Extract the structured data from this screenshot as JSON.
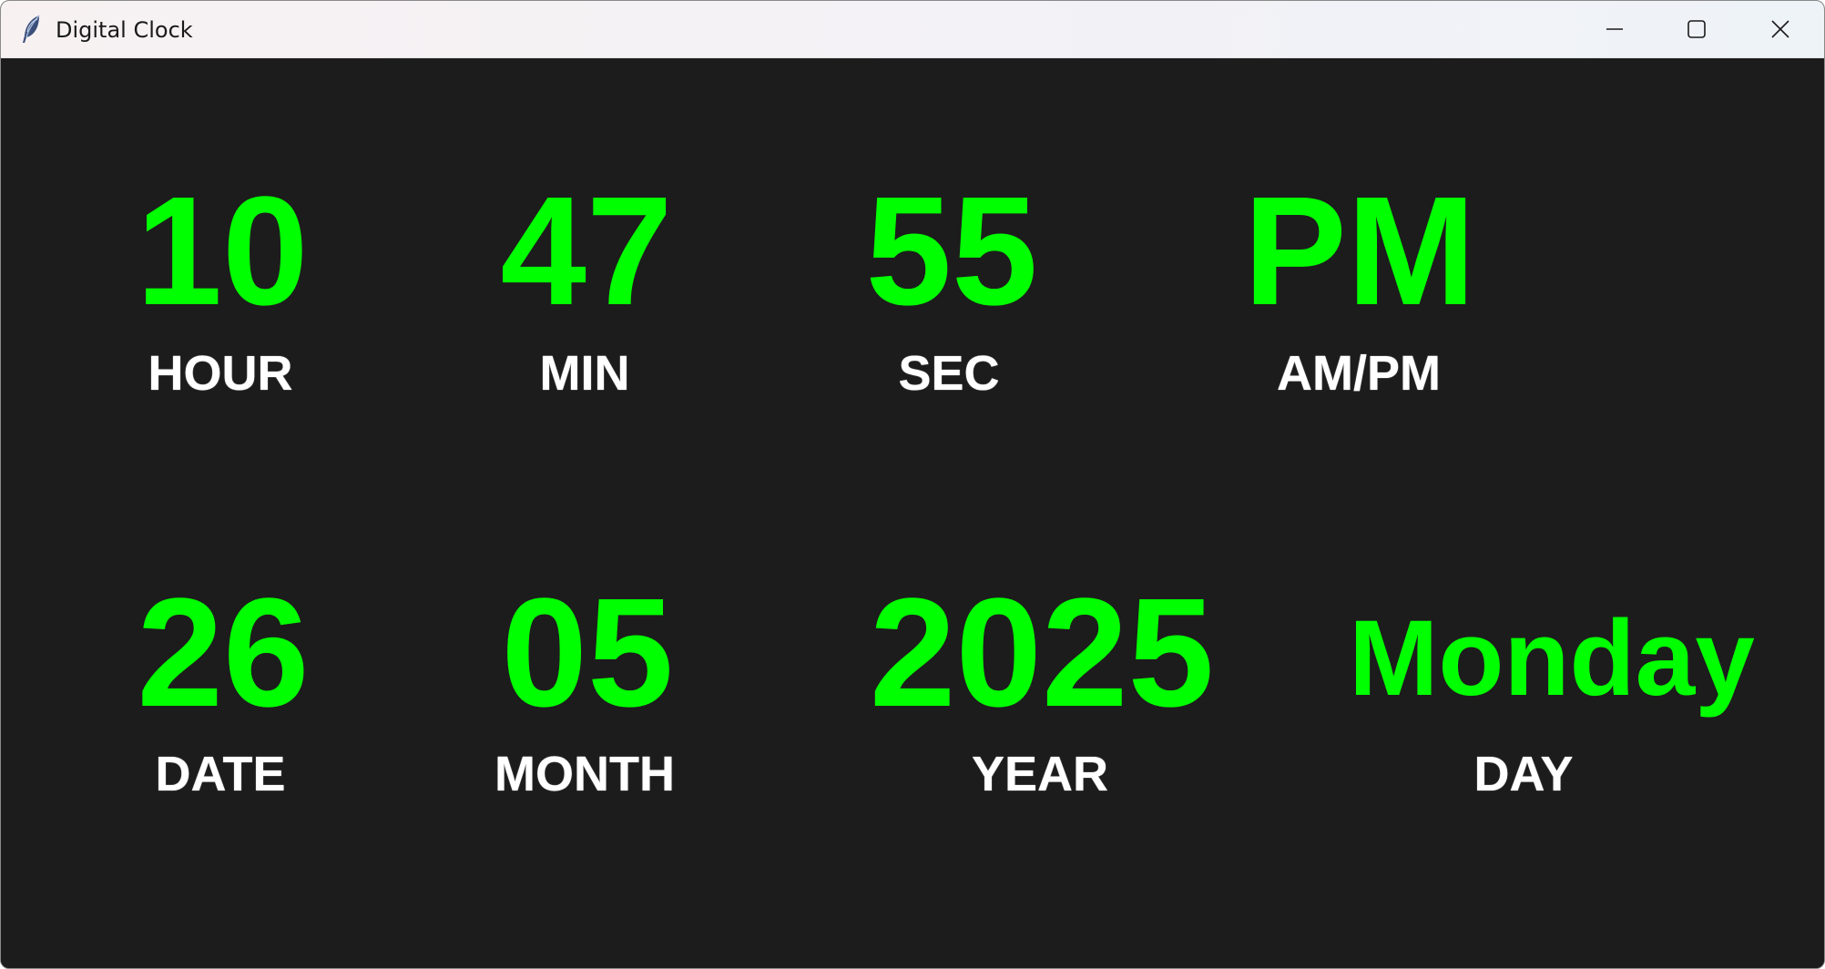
{
  "window": {
    "title": "Digital Clock",
    "controls": {
      "minimize_icon": "minimize-icon",
      "maximize_icon": "maximize-icon",
      "close_icon": "close-icon"
    }
  },
  "colors": {
    "background": "#1c1c1c",
    "value": "#00ff00",
    "label": "#ffffff"
  },
  "time": {
    "hour": {
      "value": "10",
      "label": "HOUR"
    },
    "min": {
      "value": "47",
      "label": "MIN"
    },
    "sec": {
      "value": "55",
      "label": "SEC"
    },
    "ampm": {
      "value": "PM",
      "label": "AM/PM"
    }
  },
  "date": {
    "date": {
      "value": "26",
      "label": "DATE"
    },
    "month": {
      "value": "05",
      "label": "MONTH"
    },
    "year": {
      "value": "2025",
      "label": "YEAR"
    },
    "day": {
      "value": "Monday",
      "label": "DAY"
    }
  }
}
